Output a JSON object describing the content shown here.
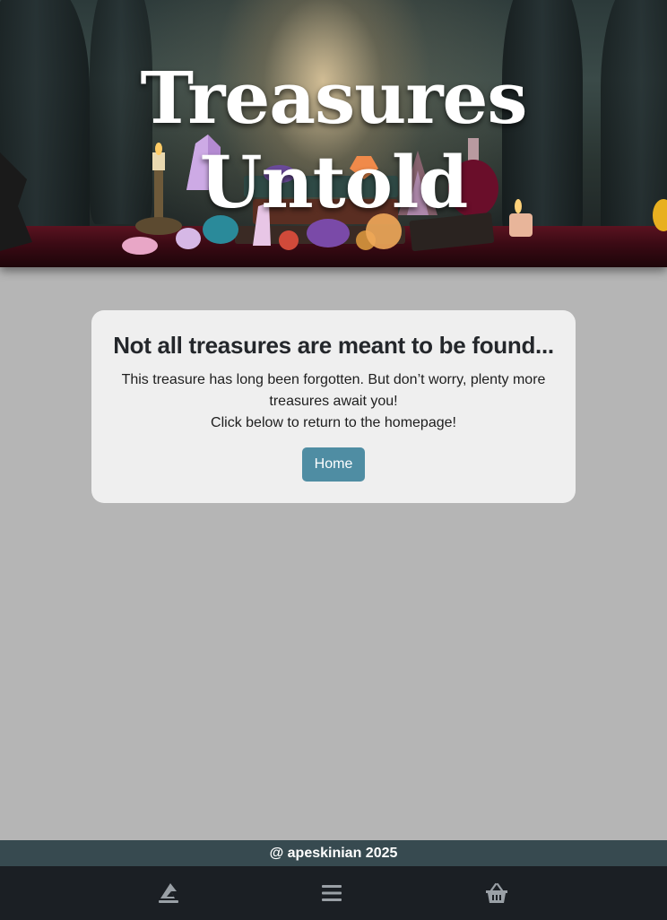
{
  "header": {
    "site_title": "Treasures Untold",
    "banner_image": "wizard-table-with-crystals-and-books"
  },
  "error_card": {
    "heading": "Not all treasures are meant to be found...",
    "message_line1": "This treasure has long been forgotten. But don’t worry, plenty more treasures await you!",
    "message_line2": "Click below to return to the homepage!",
    "home_button_label": "Home"
  },
  "footer": {
    "copyright": "@ apeskinian 2025"
  },
  "bottom_nav": {
    "items": [
      {
        "icon": "wizard-hat-icon"
      },
      {
        "icon": "menu-icon"
      },
      {
        "icon": "basket-icon"
      }
    ]
  },
  "colors": {
    "page_background": "#b5b5b5",
    "card_background": "#efefef",
    "button_accent": "#4f8da3",
    "footer_bar": "#374a50",
    "nav_bar": "#1b1f24"
  }
}
